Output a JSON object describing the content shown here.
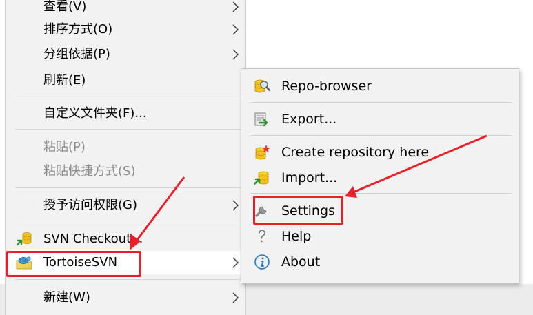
{
  "main_menu": {
    "items": [
      {
        "label": "查看(V)",
        "submenu": true
      },
      {
        "label": "排序方式(O)",
        "submenu": true
      },
      {
        "label": "分组依据(P)",
        "submenu": true
      },
      {
        "label": "刷新(E)"
      },
      {
        "label": "自定义文件夹(F)..."
      },
      {
        "label": "粘贴(P)",
        "disabled": true
      },
      {
        "label": "粘贴快捷方式(S)",
        "disabled": true
      },
      {
        "label": "授予访问权限(G)",
        "submenu": true
      },
      {
        "label": "SVN Checkout...",
        "icon": "svn-checkout-icon"
      },
      {
        "label": "TortoiseSVN",
        "icon": "tortoisesvn-icon",
        "submenu": true,
        "highlighted": true
      },
      {
        "label": "新建(W)",
        "submenu": true
      }
    ]
  },
  "submenu": {
    "items": [
      {
        "label": "Repo-browser",
        "icon": "repo-browser-icon"
      },
      {
        "label": "Export...",
        "icon": "export-icon"
      },
      {
        "label": "Create repository here",
        "icon": "create-repository-icon"
      },
      {
        "label": "Import...",
        "icon": "import-icon"
      },
      {
        "label": "Settings",
        "icon": "settings-wrench-icon",
        "highlighted": true
      },
      {
        "label": "Help",
        "icon": "help-icon"
      },
      {
        "label": "About",
        "icon": "about-icon"
      }
    ]
  },
  "annotation": {
    "highlight_color": "#e8202a"
  }
}
